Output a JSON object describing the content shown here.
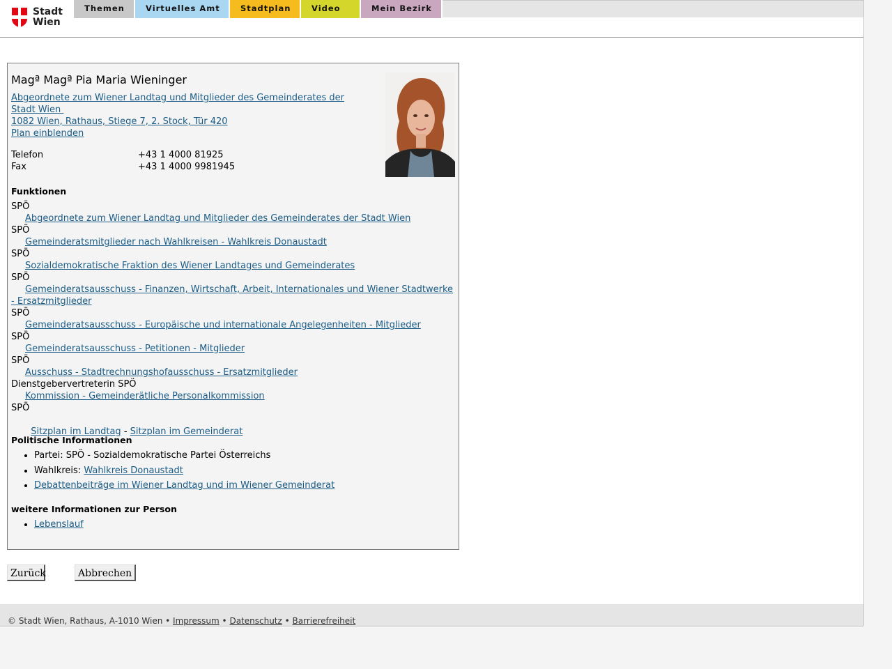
{
  "logo": {
    "line1": "Stadt",
    "line2": "Wien"
  },
  "nav": {
    "tabs": [
      {
        "label": "Themen",
        "color": "#c8c8c8"
      },
      {
        "label": "Virtuelles Amt",
        "color": "#a9d7f2"
      },
      {
        "label": "Stadtplan",
        "color": "#f6bb1c"
      },
      {
        "label": "Video",
        "color": "#d4d62c"
      },
      {
        "label": "Mein Bezirk",
        "color": "#c8a7bf"
      }
    ]
  },
  "person": {
    "name": "Magª Magª Pia Maria Wieninger",
    "role_link_line1": "Abgeordnete zum Wiener Landtag und Mitglieder des Gemeinderates der",
    "role_link_line2": "Stadt Wien ",
    "address": "1082 Wien, Rathaus, Stiege 7, 2. Stock, Tür 420",
    "plan_link": "Plan einblenden",
    "phone_label": "Telefon",
    "phone_value": "+43 1 4000 81925",
    "fax_label": "Fax",
    "fax_value": "+43 1 4000 9981945"
  },
  "functions": {
    "heading": "Funktionen",
    "items": [
      {
        "party": "SPÖ",
        "link": "Abgeordnete zum Wiener Landtag und Mitglieder des Gemeinderates der Stadt Wien"
      },
      {
        "party": "SPÖ",
        "link": "Gemeinderatsmitglieder nach Wahlkreisen - Wahlkreis Donaustadt"
      },
      {
        "party": "SPÖ",
        "link": "Sozialdemokratische Fraktion des Wiener Landtages und Gemeinderates"
      },
      {
        "party": "SPÖ",
        "link_line1": "Gemeinderatsausschuss - Finanzen, Wirtschaft, Arbeit, Internationales und Wiener Stadtwerke",
        "link_line2": "- Ersatzmitglieder"
      },
      {
        "party": "SPÖ",
        "link": "Gemeinderatsausschuss - Europäische und internationale Angelegenheiten - Mitglieder"
      },
      {
        "party": "SPÖ",
        "link": "Gemeinderatsausschuss - Petitionen - Mitglieder"
      },
      {
        "party": "SPÖ",
        "link": "Ausschuss - Stadtrechnungshofausschuss - Ersatzmitglieder"
      },
      {
        "party": "Dienstgebervertreterin SPÖ",
        "link": "Kommission - Gemeinderätliche Personalkommission"
      },
      {
        "party": "SPÖ",
        "link_a": "Sitzplan im Landtag",
        "separator": " - ",
        "link_b": "Sitzplan im Gemeinderat"
      }
    ]
  },
  "political": {
    "heading": "Politische Informationen",
    "party": "Partei: SPÖ - Sozialdemokratische Partei Österreichs",
    "district_label": "Wahlkreis: ",
    "district_link": "Wahlkreis Donaustadt",
    "debates_link": "Debattenbeiträge im Wiener Landtag und im Wiener Gemeinderat"
  },
  "more": {
    "heading": "weitere Informationen zur Person",
    "cv_link": "Lebenslauf"
  },
  "buttons": {
    "back": "Zurück",
    "cancel": "Abbrechen"
  },
  "footer": {
    "copyright": "© Stadt Wien, Rathaus, A-1010 Wien • ",
    "impressum": "Impressum",
    "sep1": " • ",
    "datenschutz": "Datenschutz",
    "sep2": " • ",
    "barrierefreiheit": "Barrierefreiheit"
  }
}
